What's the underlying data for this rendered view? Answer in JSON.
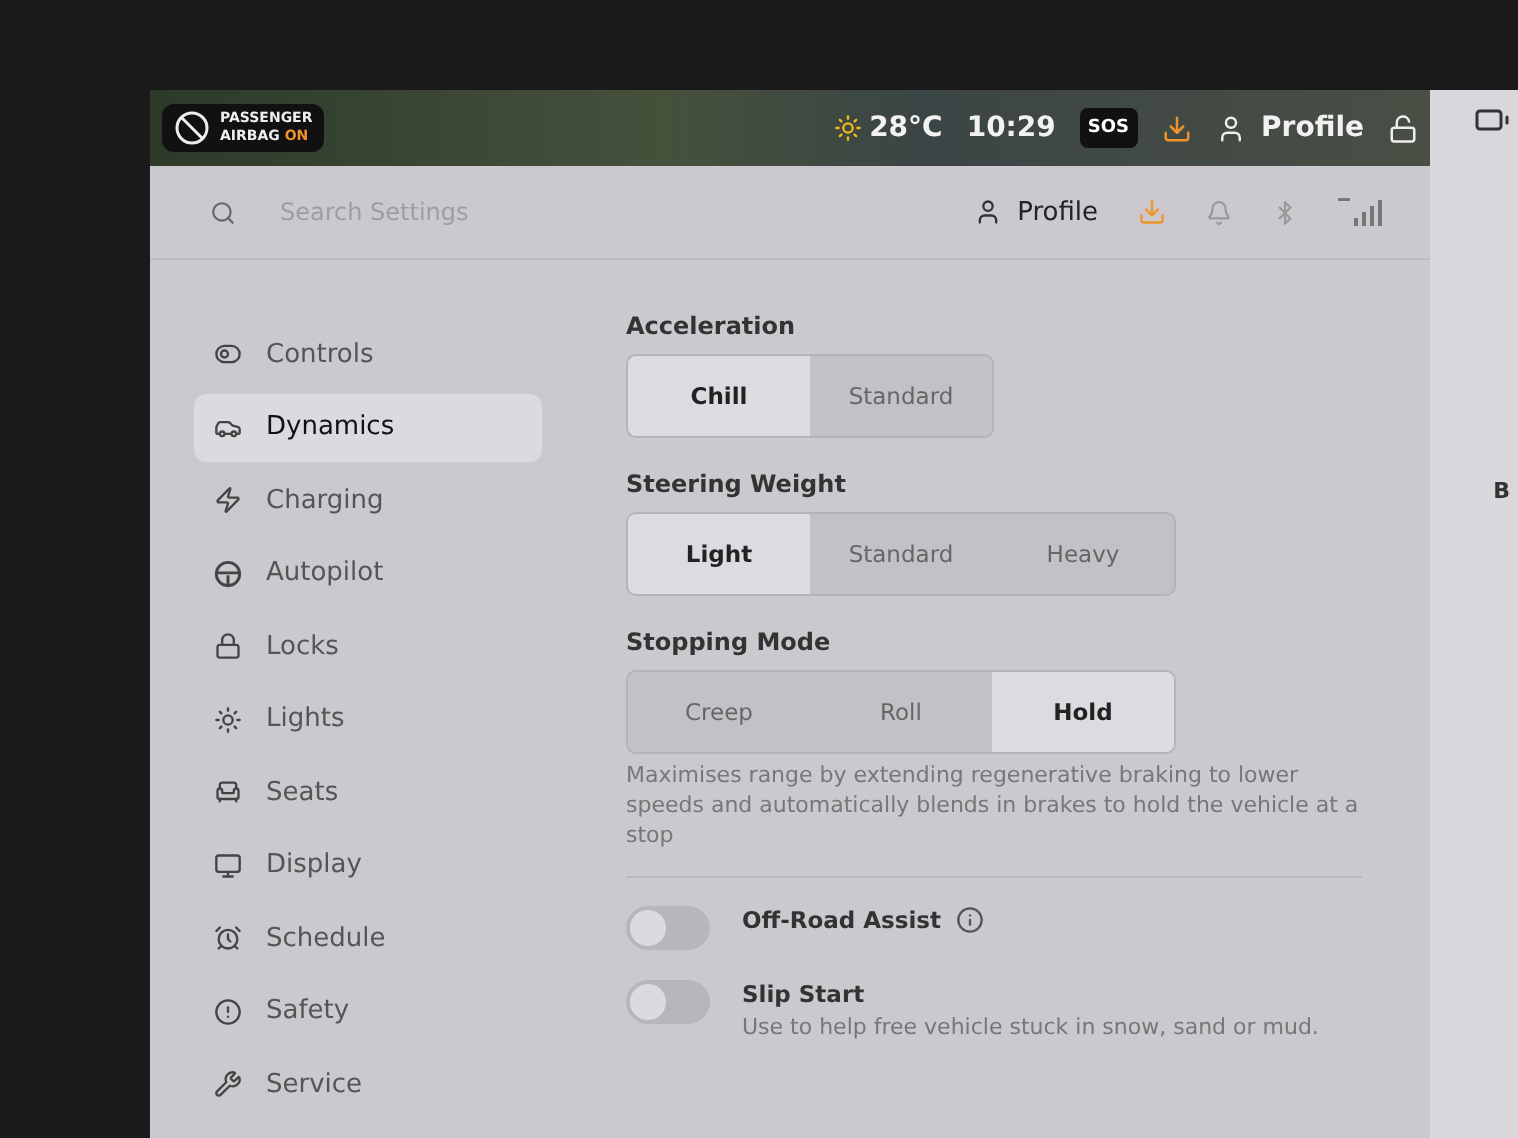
{
  "status_bar": {
    "airbag": {
      "line1": "PASSENGER",
      "line2": "AIRBAG",
      "state": "ON"
    },
    "temperature": "28°C",
    "time": "10:29",
    "sos": "SOS",
    "update_available": true,
    "profile": "Profile",
    "locked": false
  },
  "header": {
    "search": {
      "placeholder": "Search Settings"
    },
    "profile": "Profile",
    "update_available": true
  },
  "sidebar": {
    "items": [
      {
        "label": "Controls",
        "selected": false
      },
      {
        "label": "Dynamics",
        "selected": true
      },
      {
        "label": "Charging",
        "selected": false
      },
      {
        "label": "Autopilot",
        "selected": false
      },
      {
        "label": "Locks",
        "selected": false
      },
      {
        "label": "Lights",
        "selected": false
      },
      {
        "label": "Seats",
        "selected": false
      },
      {
        "label": "Display",
        "selected": false
      },
      {
        "label": "Schedule",
        "selected": false
      },
      {
        "label": "Safety",
        "selected": false
      },
      {
        "label": "Service",
        "selected": false
      }
    ]
  },
  "settings": [
    {
      "kind": "segmented",
      "title": "Acceleration",
      "options": [
        {
          "label": "Chill",
          "selected": true
        },
        {
          "label": "Standard",
          "selected": false
        }
      ]
    },
    {
      "kind": "segmented",
      "title": "Steering Weight",
      "options": [
        {
          "label": "Light",
          "selected": true
        },
        {
          "label": "Standard",
          "selected": false
        },
        {
          "label": "Heavy",
          "selected": false
        }
      ]
    },
    {
      "kind": "segmented",
      "title": "Stopping Mode",
      "options": [
        {
          "label": "Creep",
          "selected": false
        },
        {
          "label": "Roll",
          "selected": false
        },
        {
          "label": "Hold",
          "selected": true
        }
      ],
      "description": "Maximises range by extending regenerative braking to lower speeds and automatically blends in brakes to hold the vehicle at a stop"
    },
    {
      "kind": "divider"
    },
    {
      "kind": "toggle",
      "title": "Off-Road Assist",
      "on": false,
      "info": true
    },
    {
      "kind": "toggle",
      "title": "Slip Start",
      "on": false,
      "description": "Use to help free vehicle stuck in snow, sand or mud."
    }
  ],
  "right_panel": {
    "text": "B"
  }
}
